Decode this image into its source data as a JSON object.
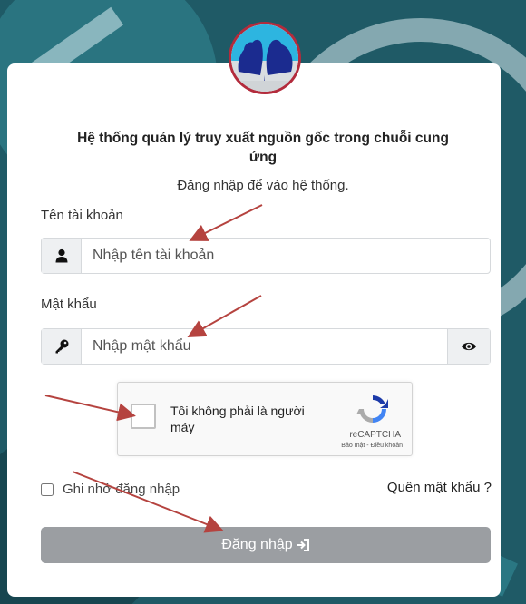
{
  "header": {
    "title": "Hệ thống quản lý truy xuất nguồn gốc trong chuỗi cung ứng",
    "subtitle": "Đăng nhập để vào hệ thống."
  },
  "username": {
    "label": "Tên tài khoản",
    "placeholder": "Nhập tên tài khoản",
    "icon": "user-icon"
  },
  "password": {
    "label": "Mật khẩu",
    "placeholder": "Nhập mật khẩu",
    "icon": "key-icon",
    "toggle_icon": "eye-icon"
  },
  "captcha": {
    "text": "Tôi không phải là người máy",
    "brand": "reCAPTCHA",
    "terms": "Bảo mật - Điều khoản"
  },
  "remember": {
    "label": "Ghi nhớ đăng nhập"
  },
  "forgot": {
    "label": "Quên mật khẩu ?"
  },
  "login": {
    "label": "Đăng nhập",
    "icon": "login-arrow-icon"
  },
  "colors": {
    "arrow": "#b5433f",
    "button": "#9b9ea2",
    "logo_ring": "#b32b3c"
  }
}
